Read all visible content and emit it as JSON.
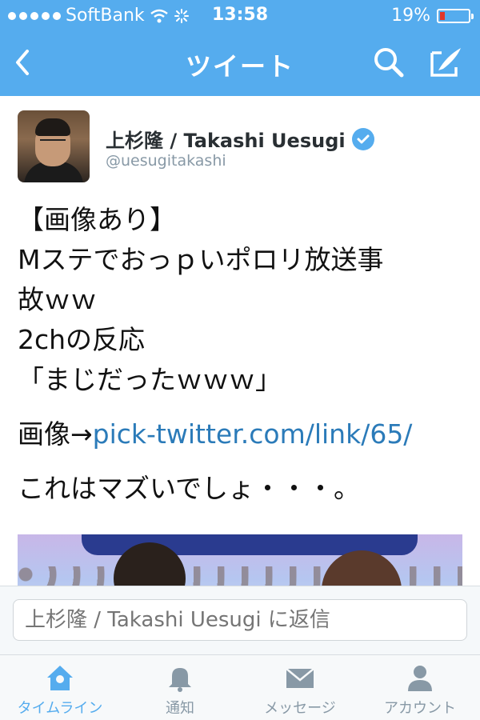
{
  "status_bar": {
    "carrier": "SoftBank",
    "time": "13:58",
    "battery_percent": "19%",
    "battery_level": 0.19,
    "signal_bars_filled": 5
  },
  "nav": {
    "title": "ツイート",
    "icons": [
      "back-icon",
      "search-icon",
      "compose-icon"
    ]
  },
  "tweet": {
    "author_name": "上杉隆 / Takashi Uesugi",
    "handle": "@uesugitakashi",
    "verified": true,
    "lines": [
      "【画像あり】",
      "Mステでおっｐいポロリ放送事",
      "故ｗｗ",
      "2chの反応",
      "「まじだったｗｗｗ」"
    ],
    "link_prefix": "画像→",
    "link_text": "pick-twitter.com/link/65/",
    "closing": "これはマズいでしょ・・・。"
  },
  "reply": {
    "placeholder": "上杉隆 / Takashi Uesugi に返信"
  },
  "tabs": [
    {
      "label": "タイムライン",
      "icon": "home-icon",
      "active": true
    },
    {
      "label": "通知",
      "icon": "bell-icon",
      "active": false
    },
    {
      "label": "メッセージ",
      "icon": "envelope-icon",
      "active": false
    },
    {
      "label": "アカウント",
      "icon": "person-icon",
      "active": false
    }
  ],
  "colors": {
    "accent": "#55acee",
    "link": "#2b7bb9",
    "battery_low": "#e0362b"
  }
}
